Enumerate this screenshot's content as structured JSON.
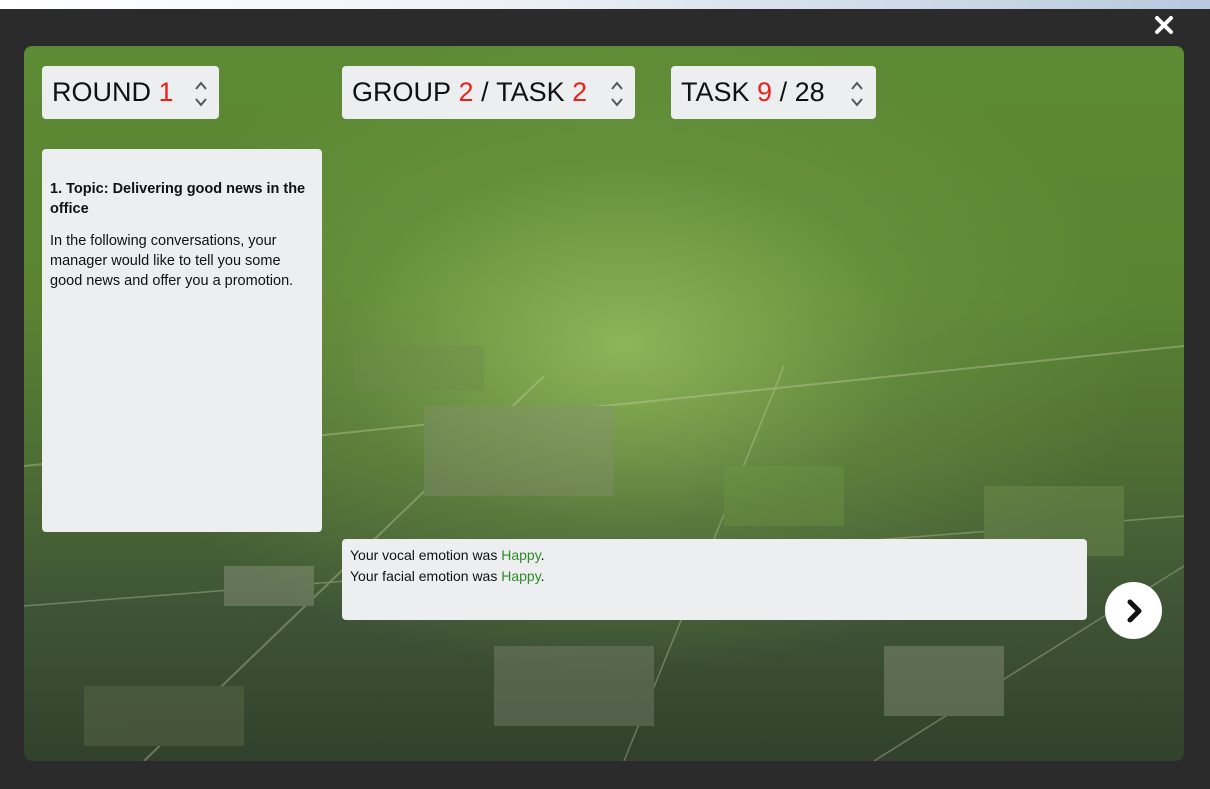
{
  "window": {
    "close_icon": "close-icon"
  },
  "round": {
    "label": "ROUND",
    "value": "1"
  },
  "group_task": {
    "group_label": "GROUP",
    "group_value": "2",
    "separator": "/",
    "task_label": "TASK",
    "task_value": "2"
  },
  "task_progress": {
    "label": "TASK",
    "current": "9",
    "separator": "/",
    "total": "28"
  },
  "topic": {
    "heading": "1.   Topic: Delivering good news in the office",
    "body": "In the following conversations, your manager would like to tell you some good news and offer you a promotion."
  },
  "feedback": {
    "vocal_prefix": "Your vocal emotion was ",
    "vocal_value": "Happy",
    "facial_prefix": "Your facial emotion was ",
    "facial_value": "Happy",
    "suffix": "."
  },
  "colors": {
    "accent_number": "#e8231c",
    "emotion_green": "#2f8a2a",
    "panel_bg": "#eceeef"
  },
  "icons": {
    "stepper": "up-down-chevron-icon",
    "next": "chevron-right-icon"
  }
}
